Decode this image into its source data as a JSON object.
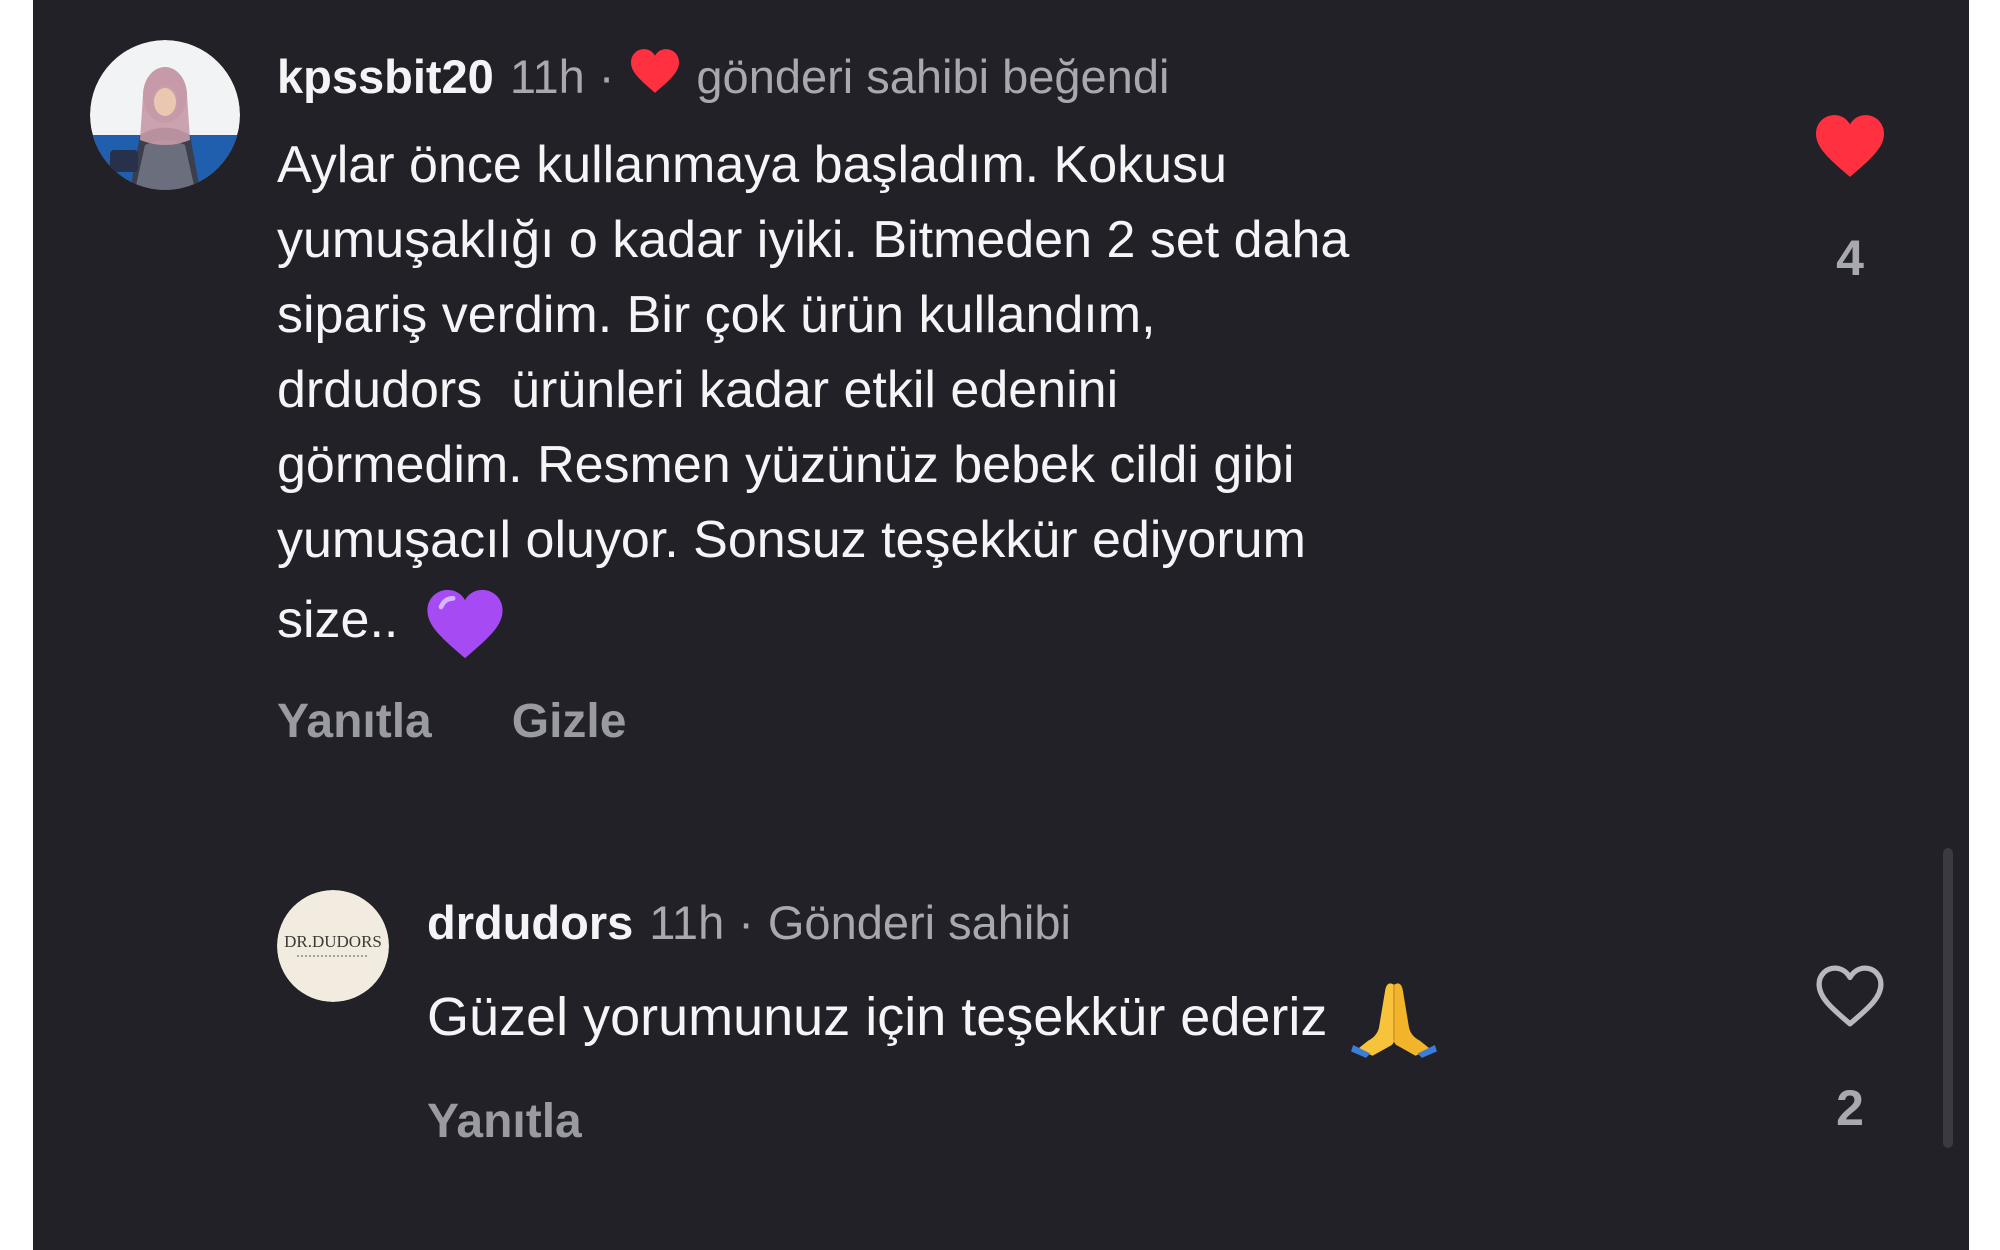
{
  "comments": [
    {
      "username": "kpssbit20",
      "time": "11h",
      "separator": "·",
      "liked_by_author_label": "gönderi sahibi beğendi",
      "lines": [
        "Aylar önce kullanmaya başladım. Kokusu",
        "yumuşaklığı o kadar iyiki. Bitmeden 2 set daha",
        "sipariş verdim. Bir çok ürün kullandım,",
        "drdudors  ürünleri kadar etkil edenini",
        "görmedim. Resmen yüzünüz bebek cildi gibi",
        "yumuşacıl oluyor. Sonsuz teşekkür ediyorum",
        "size.."
      ],
      "emoji": "purple-heart",
      "actions": {
        "reply": "Yanıtla",
        "hide": "Gizle"
      },
      "like_count": "4",
      "liked": true
    },
    {
      "username": "drdudors",
      "time": "11h",
      "separator": "·",
      "author_badge": "Gönderi sahibi",
      "avatar_text": "DR.DUDORS",
      "lines": [
        "Güzel yorumunuz için teşekkür ederiz"
      ],
      "emoji": "folded-hands",
      "actions": {
        "reply": "Yanıtla"
      },
      "like_count": "2",
      "liked": false
    }
  ],
  "colors": {
    "background": "#212127",
    "like_red": "#ff3040",
    "purple_heart": "#a64bf4",
    "meta_gray": "#a8a8b0",
    "action_gray": "#9a9aa3"
  }
}
